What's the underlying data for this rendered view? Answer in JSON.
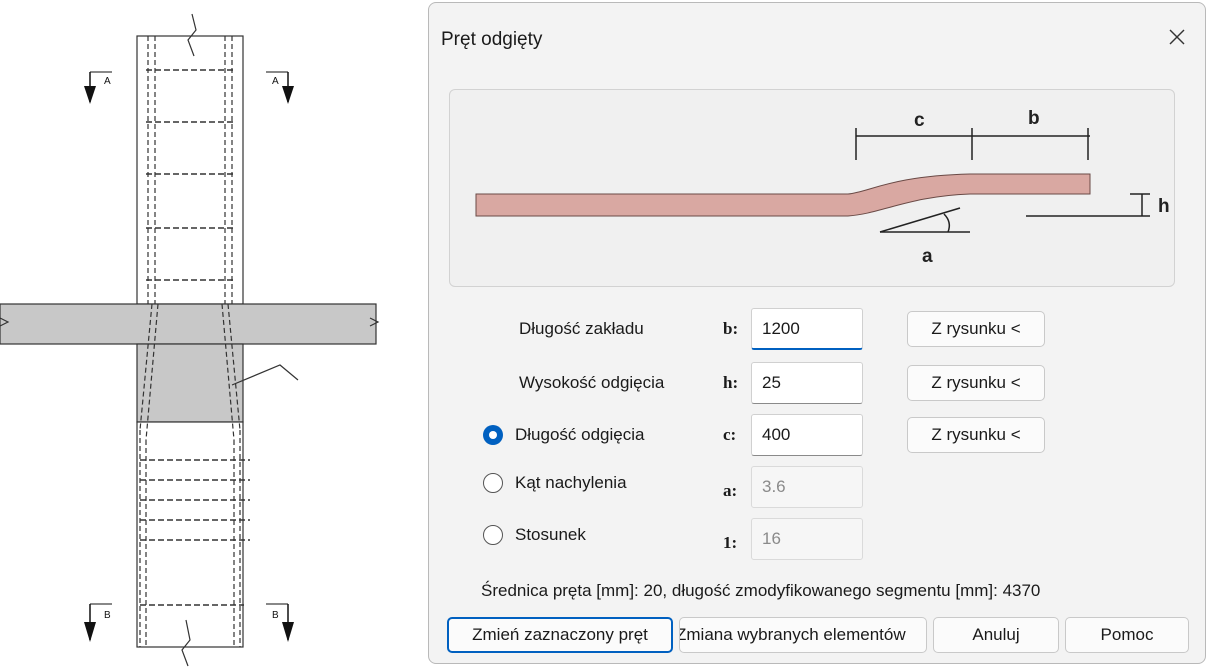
{
  "cad_drawing": {
    "section_marks": [
      "A",
      "A",
      "B",
      "B"
    ]
  },
  "dialog": {
    "title": "Pręt odgięty",
    "close_icon": "close-icon",
    "preview": {
      "labels": {
        "c": "c",
        "b": "b",
        "h": "h",
        "a": "a"
      },
      "bar_color": "#d9a8a2"
    },
    "fields": [
      {
        "label": "Długość zakładu",
        "symbol": "b:",
        "value": "1200",
        "state": "focused",
        "button": "Z rysunku <"
      },
      {
        "label": "Wysokość odgięcia",
        "symbol": "h:",
        "value": "25",
        "state": "normal",
        "button": "Z rysunku <"
      },
      {
        "label": "Długość odgięcia",
        "symbol": "c:",
        "value": "400",
        "state": "normal",
        "button": "Z rysunku <",
        "radio": "selected"
      },
      {
        "label": "Kąt nachylenia",
        "symbol": "a:",
        "value": "3.6",
        "state": "disabled",
        "radio": "unselected"
      },
      {
        "label": "Stosunek",
        "symbol": "1:",
        "value": "16",
        "state": "disabled",
        "radio": "unselected"
      }
    ],
    "info": "Średnica pręta [mm]: 20, długość zmodyfikowanego segmentu [mm]: 4370",
    "buttons": {
      "change_selected": "Zmień zaznaczony pręt",
      "change_elements": "Zmiana wybranych elementów",
      "cancel": "Anuluj",
      "help": "Pomoc"
    },
    "accent_color": "#0060c0"
  }
}
